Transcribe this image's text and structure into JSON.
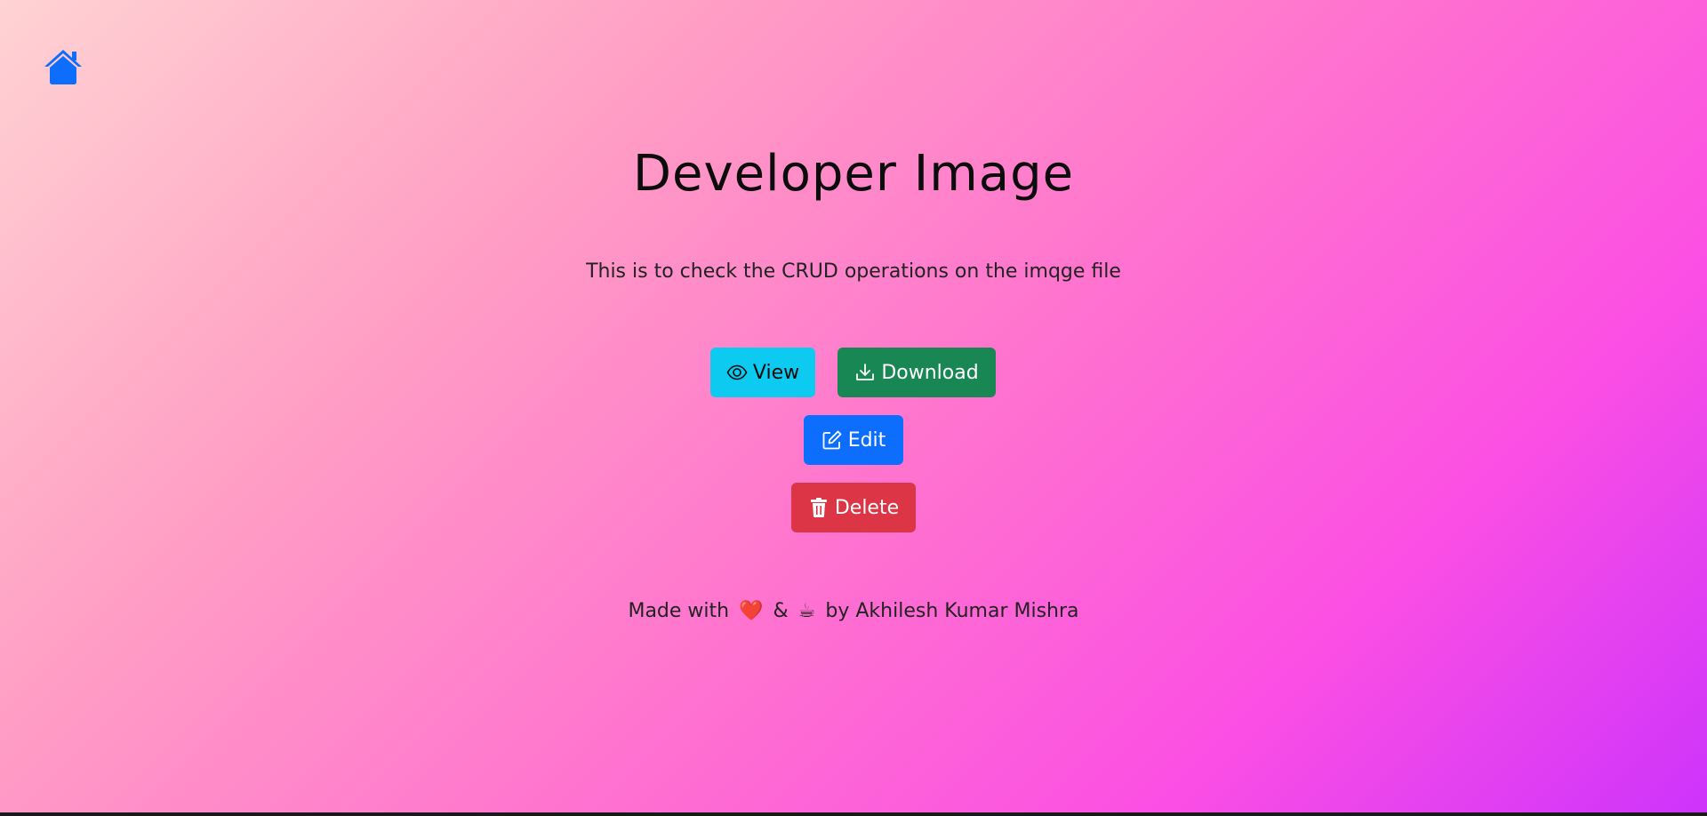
{
  "nav": {
    "home_icon": "house-fill-icon",
    "home_color": "#0d6efd"
  },
  "header": {
    "title": "Developer Image",
    "subtitle": "This is to check the CRUD operations on the imqge file"
  },
  "actions": {
    "view_label": "View",
    "view_icon": "eye-icon",
    "view_color": "#0dcaf0",
    "download_label": "Download",
    "download_icon": "download-icon",
    "download_color": "#198754",
    "edit_label": "Edit",
    "edit_icon": "pencil-square-icon",
    "edit_color": "#0d6efd",
    "delete_label": "Delete",
    "delete_icon": "trash-icon",
    "delete_color": "#dc3545"
  },
  "footer": {
    "made_with": "Made with",
    "heart": "❤️",
    "and": "&",
    "coffee": "☕",
    "by": "by Akhilesh Kumar Mishra"
  }
}
